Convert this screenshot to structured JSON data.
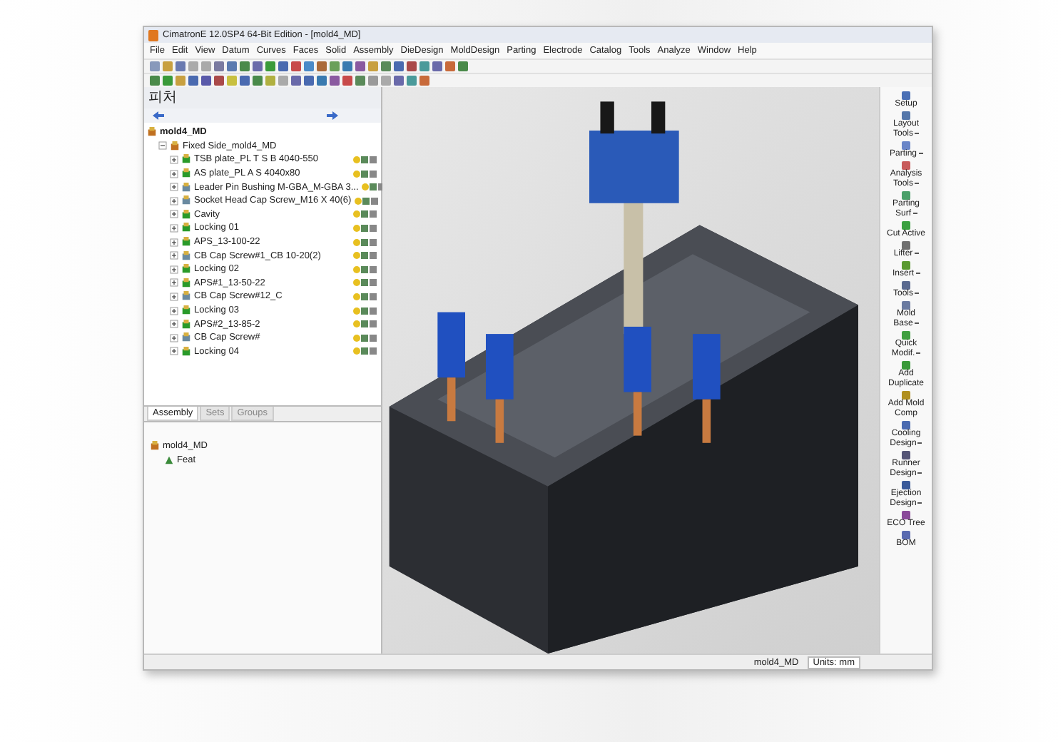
{
  "window": {
    "title": "CimatronE 12.0SP4  64-Bit Edition - [mold4_MD]"
  },
  "menu": [
    "File",
    "Edit",
    "View",
    "Datum",
    "Curves",
    "Faces",
    "Solid",
    "Assembly",
    "DieDesign",
    "MoldDesign",
    "Parting",
    "Electrode",
    "Catalog",
    "Tools",
    "Analyze",
    "Window",
    "Help"
  ],
  "feature_panel": {
    "title": "피처",
    "tree": {
      "label": "mold4_MD",
      "kind": "assembly",
      "children": [
        {
          "label": "Fixed Side_mold4_MD",
          "kind": "assembly",
          "expanded": true,
          "children": [
            {
              "label": "TSB plate_PL T S B 4040-550",
              "kind": "part",
              "expanded": false
            },
            {
              "label": "AS plate_PL A S 4040x80",
              "kind": "part",
              "expanded": false
            },
            {
              "label": "Leader Pin Bushing M-GBA_M-GBA 3...",
              "kind": "catalog",
              "expanded": false
            },
            {
              "label": "Socket Head Cap Screw_M16 X 40(6)",
              "kind": "catalog",
              "expanded": false
            },
            {
              "label": "Cavity",
              "kind": "part",
              "expanded": false
            },
            {
              "label": "Locking 01",
              "kind": "part",
              "expanded": false
            },
            {
              "label": "APS_13-100-22",
              "kind": "part",
              "expanded": false
            },
            {
              "label": "CB Cap Screw#1_CB 10-20(2)",
              "kind": "catalog",
              "expanded": false
            },
            {
              "label": "Locking 02",
              "kind": "part",
              "expanded": false
            },
            {
              "label": "APS#1_13-50-22",
              "kind": "part",
              "expanded": false
            },
            {
              "label": "CB Cap Screw#12_C",
              "kind": "catalog",
              "expanded": false
            },
            {
              "label": "Locking 03",
              "kind": "part",
              "expanded": false
            },
            {
              "label": "APS#2_13-85-2",
              "kind": "part",
              "expanded": false
            },
            {
              "label": "CB Cap Screw#",
              "kind": "catalog",
              "expanded": false
            },
            {
              "label": "Locking 04",
              "kind": "part",
              "expanded": false
            }
          ]
        }
      ]
    },
    "tabs": [
      {
        "label": "Assembly",
        "selected": true
      },
      {
        "label": "Sets",
        "selected": false
      },
      {
        "label": "Groups",
        "selected": false
      }
    ]
  },
  "lower_panel": {
    "root": "mold4_MD",
    "child": "Feat"
  },
  "mold_toolbar": [
    {
      "label": "Setup",
      "menu": false,
      "color": "#4a6fb5"
    },
    {
      "label": "Layout\nTools",
      "menu": true,
      "color": "#5577aa"
    },
    {
      "label": "Parting",
      "menu": true,
      "color": "#6a86c8"
    },
    {
      "label": "Analysis\nTools",
      "menu": true,
      "color": "#c85a5a"
    },
    {
      "label": "Parting\nSurf",
      "menu": true,
      "color": "#4aa06a"
    },
    {
      "label": "Cut Active",
      "menu": false,
      "color": "#3aa040"
    },
    {
      "label": "Lifter",
      "menu": true,
      "color": "#707070"
    },
    {
      "label": "Insert",
      "menu": true,
      "color": "#5a9a30"
    },
    {
      "label": "Tools",
      "menu": true,
      "color": "#5a6a90"
    },
    {
      "label": "Mold\nBase",
      "menu": true,
      "color": "#6a7aa0"
    },
    {
      "label": "Quick\nModif.",
      "menu": true,
      "color": "#40a040"
    },
    {
      "label": "Add\nDuplicate",
      "menu": false,
      "color": "#3a9a3a"
    },
    {
      "label": "Add Mold\nComp",
      "menu": false,
      "color": "#b09020"
    },
    {
      "label": "Cooling\nDesign",
      "menu": true,
      "color": "#4a6ab0"
    },
    {
      "label": "Runner\nDesign",
      "menu": true,
      "color": "#555577"
    },
    {
      "label": "Ejection\nDesign",
      "menu": true,
      "color": "#3a5a9a"
    },
    {
      "label": "ECO Tree",
      "menu": false,
      "color": "#8a4a9a"
    },
    {
      "label": "BOM",
      "menu": false,
      "color": "#5a6ab0"
    }
  ],
  "status_bar": {
    "file": "mold4_MD",
    "units": "Units: mm"
  }
}
